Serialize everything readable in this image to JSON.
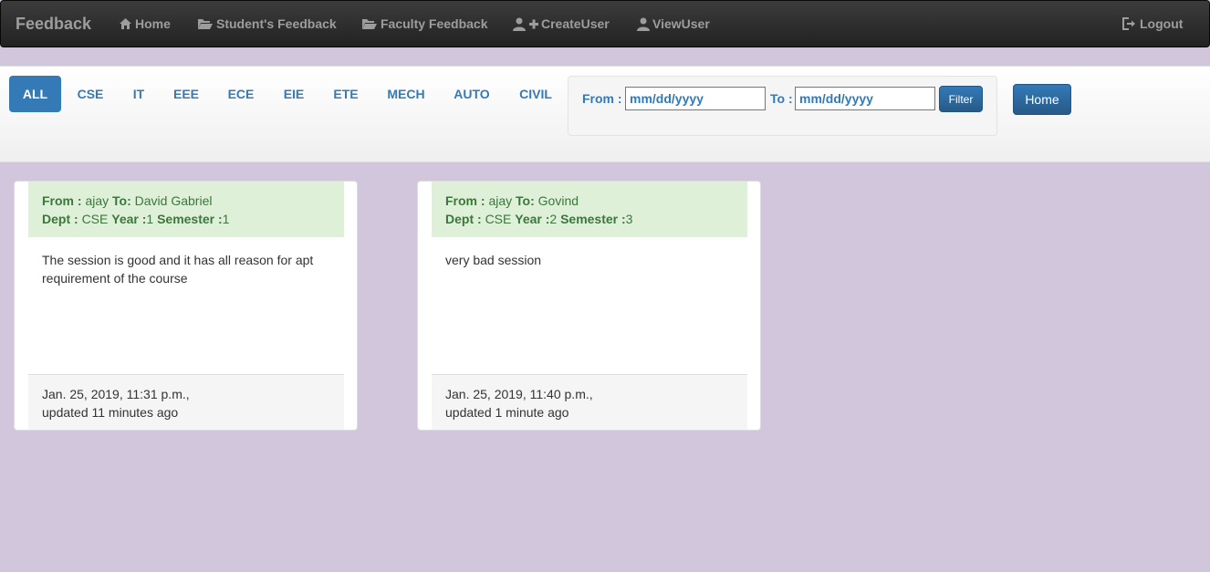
{
  "navbar": {
    "brand": "Feedback",
    "links": [
      {
        "label": "Home",
        "icon": "home-icon"
      },
      {
        "label": "Student's Feedback",
        "icon": "folder-open-icon"
      },
      {
        "label": "Faculty Feedback",
        "icon": "folder-open-icon"
      },
      {
        "label": "CreateUser",
        "icon": "user-plus-icon"
      },
      {
        "label": "ViewUser",
        "icon": "user-icon"
      },
      {
        "label": "Logout",
        "icon": "logout-icon"
      }
    ]
  },
  "departments": [
    "ALL",
    "CSE",
    "IT",
    "EEE",
    "ECE",
    "EIE",
    "ETE",
    "MECH",
    "AUTO",
    "CIVIL"
  ],
  "active_department": "ALL",
  "date_filter": {
    "from_label": "From :",
    "to_label": "To :",
    "from_placeholder": "mm/dd/yyyy",
    "to_placeholder": "mm/dd/yyyy",
    "filter_button": "Filter"
  },
  "home_button": "Home",
  "feedback_cards": [
    {
      "from_label": "From :",
      "from": "ajay",
      "to_label": "To:",
      "to": "David Gabriel",
      "dept_label": "Dept :",
      "dept": "CSE",
      "year_label": "Year :",
      "year": "1",
      "semester_label": "Semester :",
      "semester": "1",
      "body": "The session is good and it has all reason for apt requirement of the course",
      "created": "Jan. 25, 2019, 11:31 p.m.,",
      "updated": "updated 11 minutes ago"
    },
    {
      "from_label": "From :",
      "from": "ajay",
      "to_label": "To:",
      "to": "Govind",
      "dept_label": "Dept :",
      "dept": "CSE",
      "year_label": "Year :",
      "year": "2",
      "semester_label": "Semester :",
      "semester": "3",
      "body": "very bad session",
      "created": "Jan. 25, 2019, 11:40 p.m.,",
      "updated": "updated 1 minute ago"
    }
  ],
  "colors": {
    "page_bg": "#d1c6db",
    "accent": "#337ab7",
    "card_header_bg": "#dff0d8",
    "card_header_text": "#3c763d",
    "navbar_text": "#9d9d9d"
  }
}
